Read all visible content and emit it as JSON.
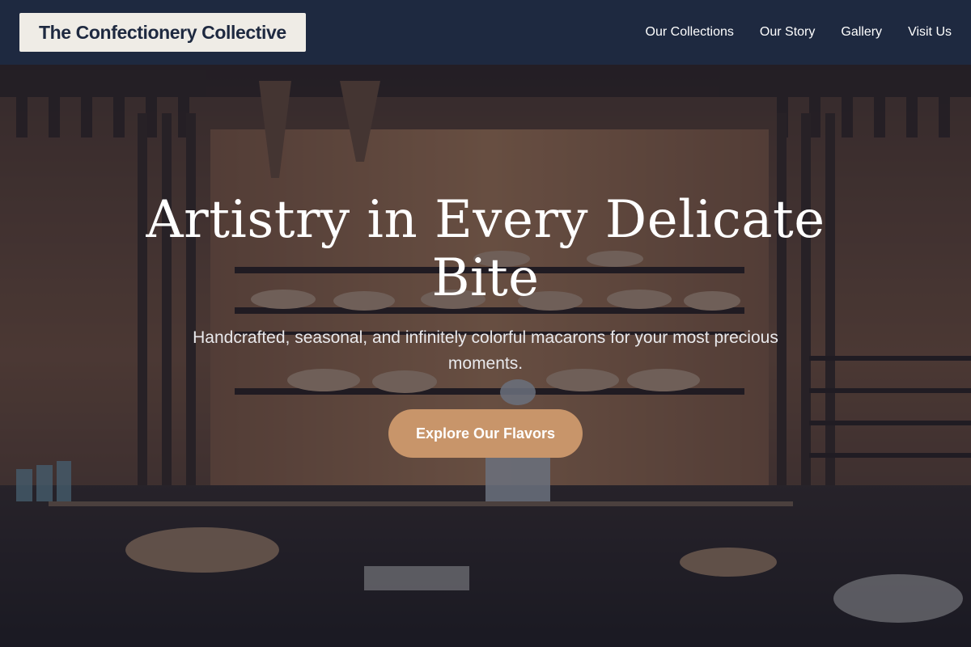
{
  "nav": {
    "brand": "The Confectionery Collective",
    "links": [
      "Our Collections",
      "Our Story",
      "Gallery",
      "Visit Us"
    ]
  },
  "hero": {
    "title_line1": "Artistry in Every Delicate",
    "title_line2": "Bite",
    "subtitle": "Handcrafted, seasonal, and infinitely colorful macarons for your most precious moments.",
    "cta_label": "Explore Our Flavors",
    "background": "bakery-interior-photo"
  },
  "colors": {
    "nav_bg": "#1e2940",
    "brand_bg": "#efece6",
    "brand_text": "#1e2940",
    "cta_bg": "#c8956a"
  }
}
